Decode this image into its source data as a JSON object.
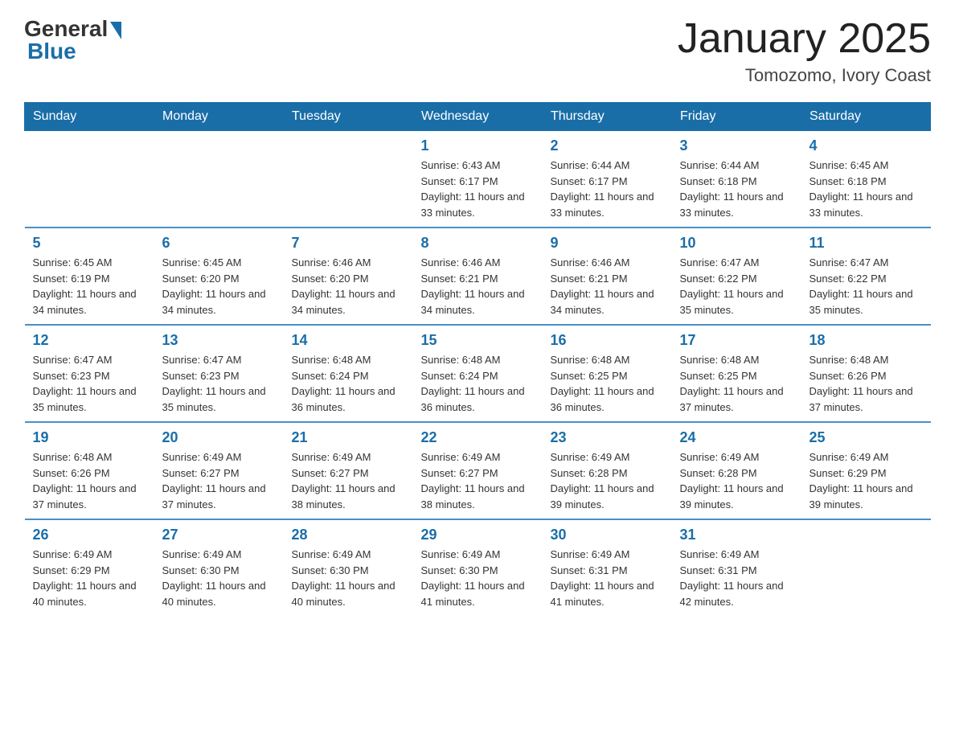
{
  "logo": {
    "general": "General",
    "blue": "Blue"
  },
  "title": "January 2025",
  "location": "Tomozomo, Ivory Coast",
  "header": {
    "days": [
      "Sunday",
      "Monday",
      "Tuesday",
      "Wednesday",
      "Thursday",
      "Friday",
      "Saturday"
    ]
  },
  "weeks": [
    [
      {
        "day": "",
        "info": ""
      },
      {
        "day": "",
        "info": ""
      },
      {
        "day": "",
        "info": ""
      },
      {
        "day": "1",
        "info": "Sunrise: 6:43 AM\nSunset: 6:17 PM\nDaylight: 11 hours and 33 minutes."
      },
      {
        "day": "2",
        "info": "Sunrise: 6:44 AM\nSunset: 6:17 PM\nDaylight: 11 hours and 33 minutes."
      },
      {
        "day": "3",
        "info": "Sunrise: 6:44 AM\nSunset: 6:18 PM\nDaylight: 11 hours and 33 minutes."
      },
      {
        "day": "4",
        "info": "Sunrise: 6:45 AM\nSunset: 6:18 PM\nDaylight: 11 hours and 33 minutes."
      }
    ],
    [
      {
        "day": "5",
        "info": "Sunrise: 6:45 AM\nSunset: 6:19 PM\nDaylight: 11 hours and 34 minutes."
      },
      {
        "day": "6",
        "info": "Sunrise: 6:45 AM\nSunset: 6:20 PM\nDaylight: 11 hours and 34 minutes."
      },
      {
        "day": "7",
        "info": "Sunrise: 6:46 AM\nSunset: 6:20 PM\nDaylight: 11 hours and 34 minutes."
      },
      {
        "day": "8",
        "info": "Sunrise: 6:46 AM\nSunset: 6:21 PM\nDaylight: 11 hours and 34 minutes."
      },
      {
        "day": "9",
        "info": "Sunrise: 6:46 AM\nSunset: 6:21 PM\nDaylight: 11 hours and 34 minutes."
      },
      {
        "day": "10",
        "info": "Sunrise: 6:47 AM\nSunset: 6:22 PM\nDaylight: 11 hours and 35 minutes."
      },
      {
        "day": "11",
        "info": "Sunrise: 6:47 AM\nSunset: 6:22 PM\nDaylight: 11 hours and 35 minutes."
      }
    ],
    [
      {
        "day": "12",
        "info": "Sunrise: 6:47 AM\nSunset: 6:23 PM\nDaylight: 11 hours and 35 minutes."
      },
      {
        "day": "13",
        "info": "Sunrise: 6:47 AM\nSunset: 6:23 PM\nDaylight: 11 hours and 35 minutes."
      },
      {
        "day": "14",
        "info": "Sunrise: 6:48 AM\nSunset: 6:24 PM\nDaylight: 11 hours and 36 minutes."
      },
      {
        "day": "15",
        "info": "Sunrise: 6:48 AM\nSunset: 6:24 PM\nDaylight: 11 hours and 36 minutes."
      },
      {
        "day": "16",
        "info": "Sunrise: 6:48 AM\nSunset: 6:25 PM\nDaylight: 11 hours and 36 minutes."
      },
      {
        "day": "17",
        "info": "Sunrise: 6:48 AM\nSunset: 6:25 PM\nDaylight: 11 hours and 37 minutes."
      },
      {
        "day": "18",
        "info": "Sunrise: 6:48 AM\nSunset: 6:26 PM\nDaylight: 11 hours and 37 minutes."
      }
    ],
    [
      {
        "day": "19",
        "info": "Sunrise: 6:48 AM\nSunset: 6:26 PM\nDaylight: 11 hours and 37 minutes."
      },
      {
        "day": "20",
        "info": "Sunrise: 6:49 AM\nSunset: 6:27 PM\nDaylight: 11 hours and 37 minutes."
      },
      {
        "day": "21",
        "info": "Sunrise: 6:49 AM\nSunset: 6:27 PM\nDaylight: 11 hours and 38 minutes."
      },
      {
        "day": "22",
        "info": "Sunrise: 6:49 AM\nSunset: 6:27 PM\nDaylight: 11 hours and 38 minutes."
      },
      {
        "day": "23",
        "info": "Sunrise: 6:49 AM\nSunset: 6:28 PM\nDaylight: 11 hours and 39 minutes."
      },
      {
        "day": "24",
        "info": "Sunrise: 6:49 AM\nSunset: 6:28 PM\nDaylight: 11 hours and 39 minutes."
      },
      {
        "day": "25",
        "info": "Sunrise: 6:49 AM\nSunset: 6:29 PM\nDaylight: 11 hours and 39 minutes."
      }
    ],
    [
      {
        "day": "26",
        "info": "Sunrise: 6:49 AM\nSunset: 6:29 PM\nDaylight: 11 hours and 40 minutes."
      },
      {
        "day": "27",
        "info": "Sunrise: 6:49 AM\nSunset: 6:30 PM\nDaylight: 11 hours and 40 minutes."
      },
      {
        "day": "28",
        "info": "Sunrise: 6:49 AM\nSunset: 6:30 PM\nDaylight: 11 hours and 40 minutes."
      },
      {
        "day": "29",
        "info": "Sunrise: 6:49 AM\nSunset: 6:30 PM\nDaylight: 11 hours and 41 minutes."
      },
      {
        "day": "30",
        "info": "Sunrise: 6:49 AM\nSunset: 6:31 PM\nDaylight: 11 hours and 41 minutes."
      },
      {
        "day": "31",
        "info": "Sunrise: 6:49 AM\nSunset: 6:31 PM\nDaylight: 11 hours and 42 minutes."
      },
      {
        "day": "",
        "info": ""
      }
    ]
  ]
}
